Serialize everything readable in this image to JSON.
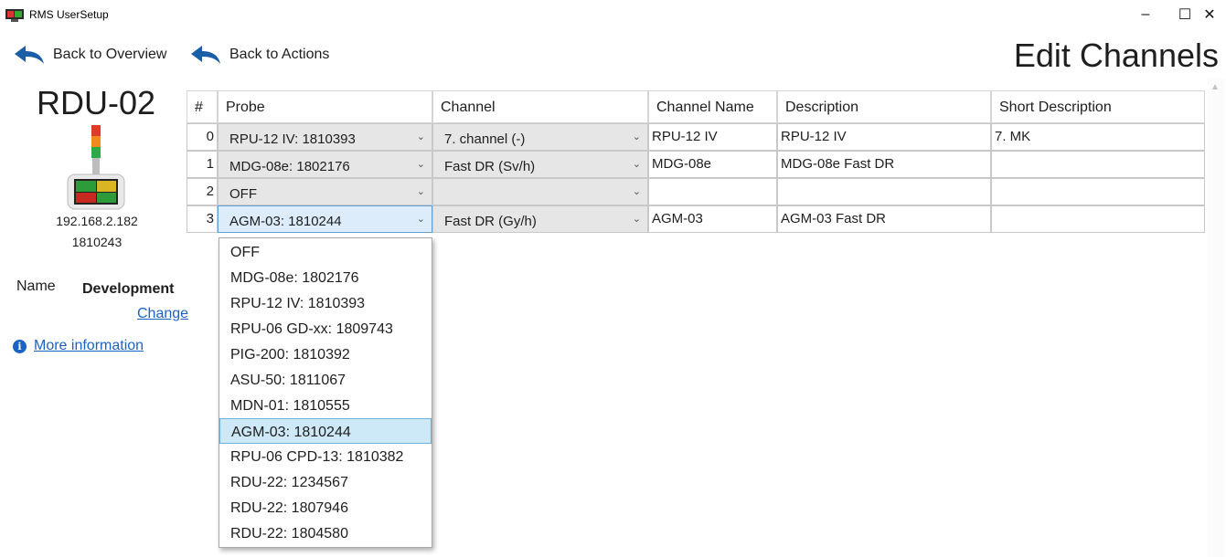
{
  "window": {
    "title": "RMS UserSetup",
    "minimize": "–",
    "maximize": "☐",
    "close": "✕"
  },
  "nav": {
    "back_overview": "Back to Overview",
    "back_actions": "Back to Actions"
  },
  "page_title": "Edit Channels",
  "device": {
    "name": "RDU-02",
    "ip": "192.168.2.182",
    "serial": "1810243",
    "name_label": "Name",
    "name_value": "Development",
    "change_link": "Change",
    "more_info": "More information"
  },
  "grid": {
    "headers": [
      "#",
      "Probe",
      "Channel",
      "Channel Name",
      "Description",
      "Short Description"
    ],
    "rows": [
      {
        "index": "0",
        "probe": "RPU-12 IV: 1810393",
        "channel": "7. channel (-)",
        "channel_name": "RPU-12 IV",
        "description": "RPU-12 IV",
        "short_description": "7. MK"
      },
      {
        "index": "1",
        "probe": "MDG-08e: 1802176",
        "channel": "Fast DR (Sv/h)",
        "channel_name": "MDG-08e",
        "description": "MDG-08e Fast DR",
        "short_description": ""
      },
      {
        "index": "2",
        "probe": "OFF",
        "channel": "",
        "channel_name": "",
        "description": "",
        "short_description": ""
      },
      {
        "index": "3",
        "probe": "AGM-03: 1810244",
        "channel": "Fast DR (Gy/h)",
        "channel_name": "AGM-03",
        "description": "AGM-03 Fast DR",
        "short_description": ""
      }
    ]
  },
  "dropdown": {
    "selected": "AGM-03: 1810244",
    "options": [
      "OFF",
      "MDG-08e: 1802176",
      "RPU-12 IV: 1810393",
      "RPU-06 GD-xx: 1809743",
      "PIG-200: 1810392",
      "ASU-50: 1811067",
      "MDN-01: 1810555",
      "AGM-03: 1810244",
      "RPU-06 CPD-13: 1810382",
      "RDU-22: 1234567",
      "RDU-22: 1807946",
      "RDU-22: 1804580"
    ]
  },
  "colors": {
    "link": "#1a63c5",
    "selection": "#cde8f7",
    "combo_bg": "#e6e6e6",
    "arrow": "#1a5ea8"
  }
}
